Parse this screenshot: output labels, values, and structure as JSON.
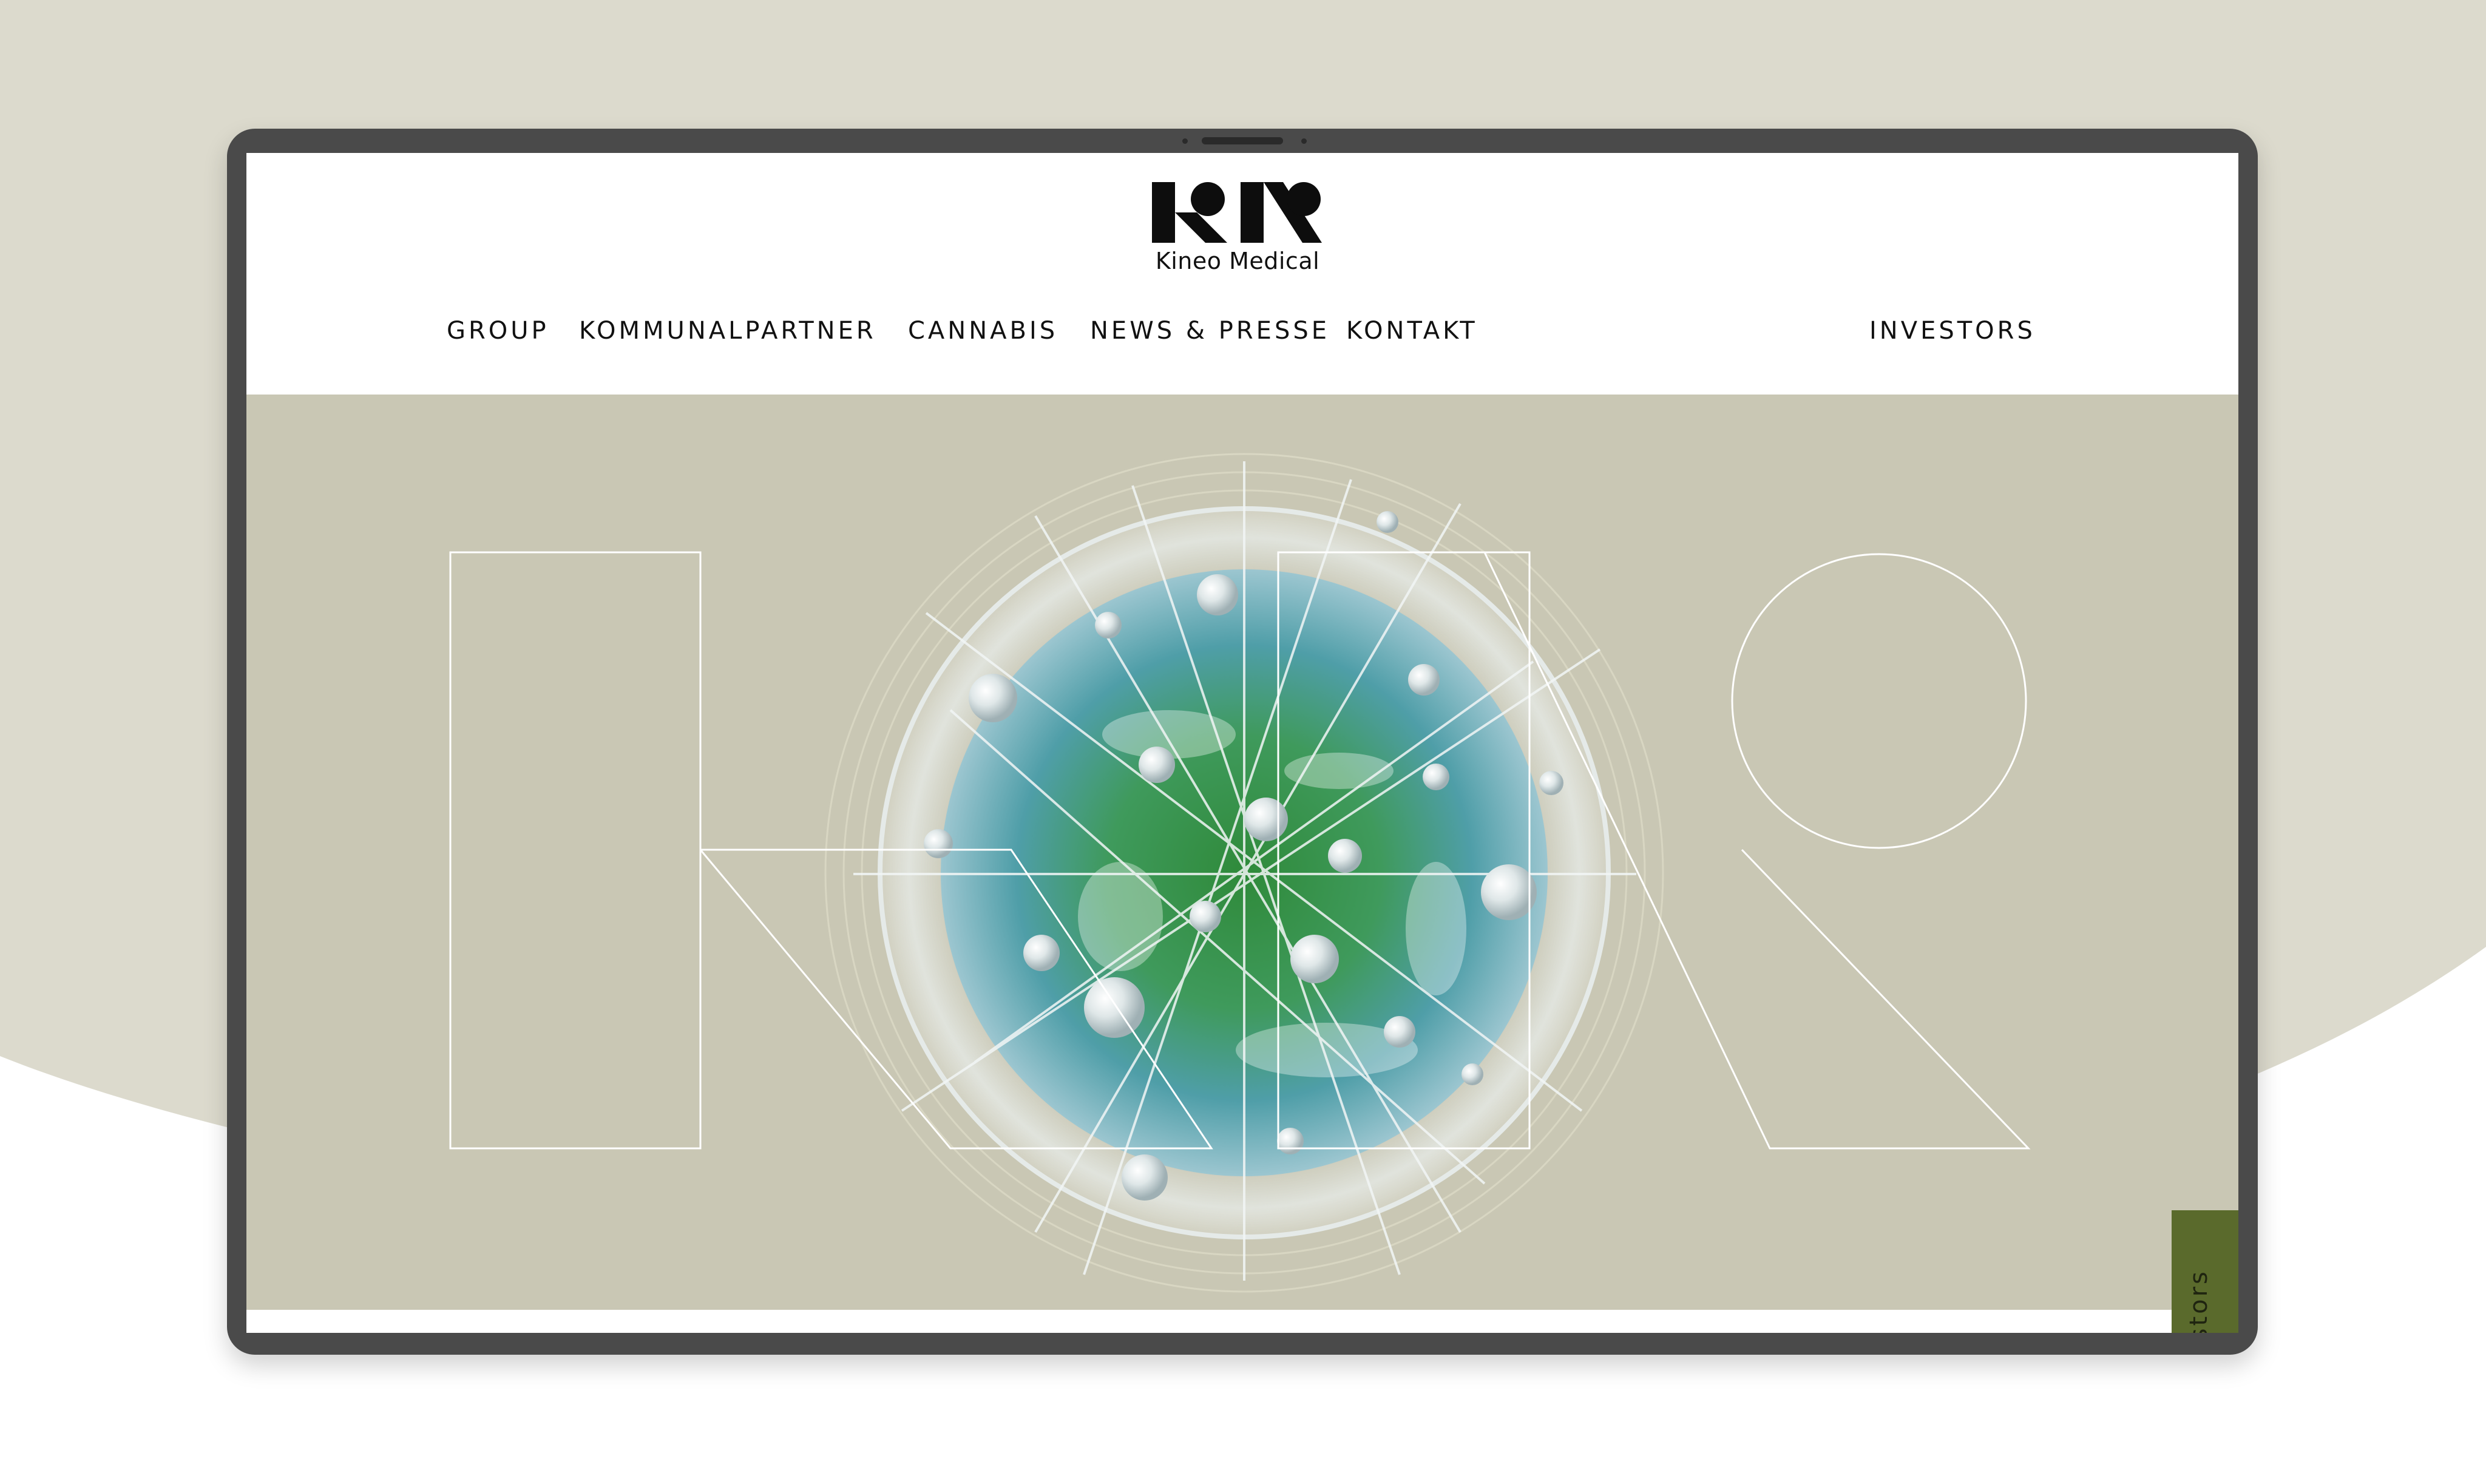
{
  "brand": {
    "name": "Kineo Medical",
    "logo_mark": "KN",
    "bg_color": "#dcdacd",
    "panel_color": "#c9c7b4",
    "accent_color": "#5a6a2c"
  },
  "nav": {
    "items": [
      {
        "label": "GROUP"
      },
      {
        "label": "KOMMUNALPARTNER"
      },
      {
        "label": "CANNABIS"
      },
      {
        "label": "NEWS & PRESSE"
      },
      {
        "label": "KONTAKT"
      }
    ],
    "investors_label": "INVESTORS"
  },
  "hero": {
    "visual": "globe-with-molecular-network",
    "outline_shapes": "KN-logo-outline"
  },
  "side_tab": {
    "label": "Investors",
    "visible_text": "estors"
  }
}
